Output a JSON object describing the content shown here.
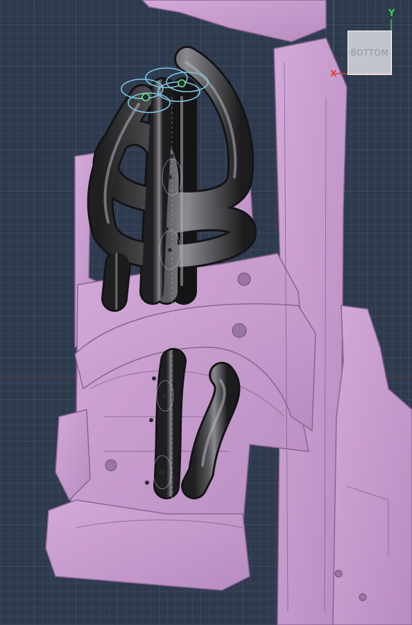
{
  "view_cube": {
    "face_label": "BOTTOM",
    "y_axis_label": "Y",
    "x_axis_label": "X"
  },
  "colors": {
    "background": "#2e3b4e",
    "scan_mesh": "#c59acb",
    "tube": "#3c3c3e",
    "handle": "#7fc7e3",
    "axis_x": "#e0403a",
    "axis_y": "#39d24a"
  },
  "icons": {
    "gizmo": "transform-handle-icon",
    "cube": "view-cube-icon"
  }
}
